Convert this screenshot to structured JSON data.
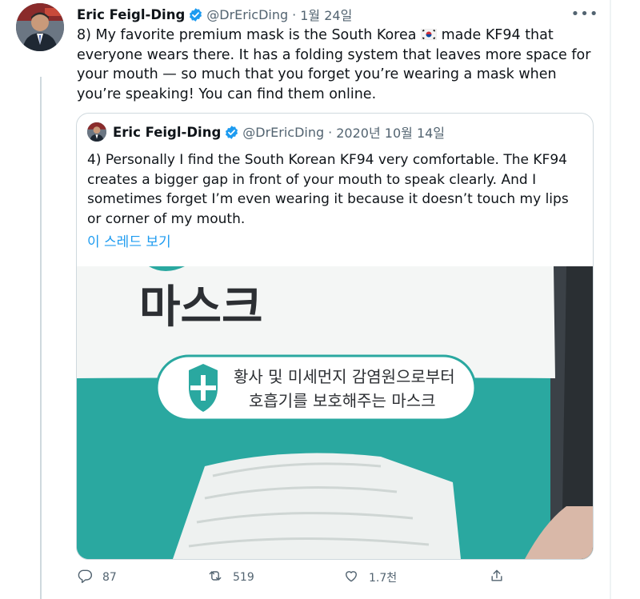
{
  "tweet": {
    "author_name": "Eric Feigl-Ding",
    "handle": "@DrEricDing",
    "separator": "·",
    "date": "1월 24일",
    "text_before_flag": "8) My favorite premium mask is the South Korea ",
    "text_after_flag": " made KF94 that everyone wears there. It has a folding system that leaves more space for your mouth — so much that you forget you’re wearing a mask when you’re speaking! You can find them online."
  },
  "quoted_tweet": {
    "author_name": "Eric Feigl-Ding",
    "handle": "@DrEricDing",
    "separator": "·",
    "date": "2020년 10월 14일",
    "text": "4) Personally I find the South Korean KF94 very comfortable. The KF94 creates a bigger gap in front of your mouth to speak clearly. And I sometimes forget I’m even wearing it because it doesn’t touch my lips or corner of my mouth.",
    "show_thread_label": "이 스레드 보기",
    "image": {
      "package_title": "마스크",
      "package_line1": "황사 및 미세먼지 감염원으로부터",
      "package_line2": "호흡기를 보호해주는 마스크"
    }
  },
  "actions": {
    "reply_count": "87",
    "retweet_count": "519",
    "like_count": "1.7천"
  },
  "colors": {
    "accent": "#1d9bf0",
    "secondary_text": "#536471",
    "mask_package_teal": "#2aa8a0"
  }
}
